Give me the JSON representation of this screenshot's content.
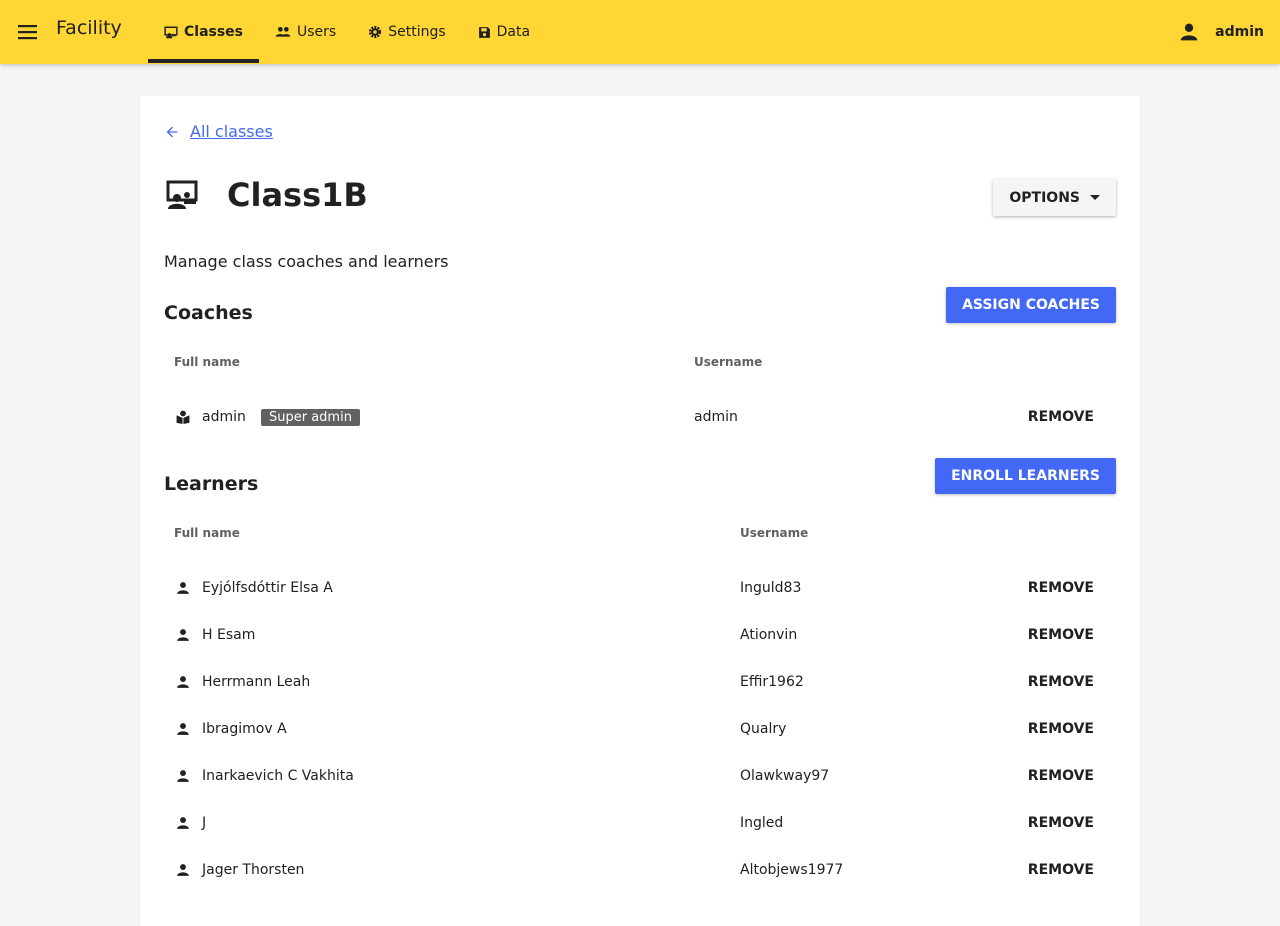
{
  "app": {
    "title": "Facility"
  },
  "nav": {
    "tabs": [
      {
        "label": "Classes",
        "icon": "classes-icon",
        "active": true
      },
      {
        "label": "Users",
        "icon": "users-icon",
        "active": false
      },
      {
        "label": "Settings",
        "icon": "gear-icon",
        "active": false
      },
      {
        "label": "Data",
        "icon": "save-icon",
        "active": false
      }
    ]
  },
  "user_menu": {
    "label": "admin",
    "icon": "person-icon"
  },
  "page": {
    "back_link": "All classes",
    "class_name": "Class1B",
    "options_label": "OPTIONS",
    "description": "Manage class coaches and learners"
  },
  "coaches": {
    "title": "Coaches",
    "assign_label": "ASSIGN COACHES",
    "col_full_name": "Full name",
    "col_username": "Username",
    "rows": [
      {
        "full_name": "admin",
        "badge": "Super admin",
        "username": "admin",
        "action": "REMOVE",
        "icon": "coach-icon"
      }
    ]
  },
  "learners": {
    "title": "Learners",
    "enroll_label": "ENROLL LEARNERS",
    "col_full_name": "Full name",
    "col_username": "Username",
    "rows": [
      {
        "full_name": "Eyjólfsdóttir Elsa A",
        "username": "Inguld83",
        "action": "REMOVE"
      },
      {
        "full_name": "H Esam",
        "username": "Ationvin",
        "action": "REMOVE"
      },
      {
        "full_name": "Herrmann Leah",
        "username": "Effir1962",
        "action": "REMOVE"
      },
      {
        "full_name": "Ibragimov A",
        "username": "Qualry",
        "action": "REMOVE"
      },
      {
        "full_name": "Inarkaevich C Vakhita",
        "username": "Olawkway97",
        "action": "REMOVE"
      },
      {
        "full_name": "J",
        "username": "Ingled",
        "action": "REMOVE"
      },
      {
        "full_name": "Jager Thorsten",
        "username": "Altobjews1977",
        "action": "REMOVE"
      }
    ]
  },
  "colors": {
    "appbar": "#ffd633",
    "primary": "#4368f5",
    "badge": "#616161"
  }
}
